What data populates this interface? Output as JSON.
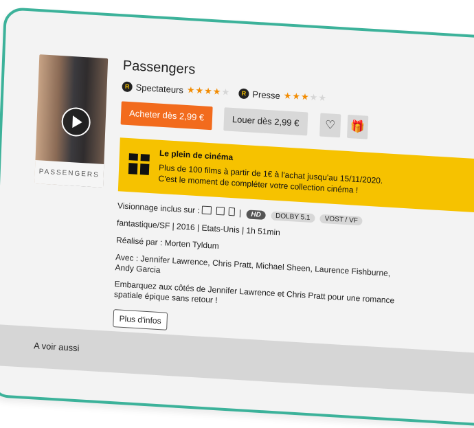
{
  "movie": {
    "title": "Passengers",
    "poster_text": "PASSENGERS",
    "spectators_label": "Spectateurs",
    "spectators_stars": 4,
    "press_label": "Presse",
    "press_stars": 3
  },
  "actions": {
    "buy_label": "Acheter dès 2,99 €",
    "rent_label": "Louer dès 2,99 €"
  },
  "promo": {
    "title": "Le plein de cinéma",
    "line1": "Plus de 100 films à partir de 1€ à l'achat jusqu'au 15/11/2020.",
    "line2": "C'est le moment de compléter votre collection cinéma !"
  },
  "details": {
    "viewing_label": "Visionnage inclus sur :",
    "tags": [
      "HD",
      "DOLBY 5.1",
      "VOST / VF"
    ],
    "genre_line": "fantastique/SF | 2016 | Etats-Unis | 1h 51min",
    "director_line": "Réalisé par : Morten Tyldum",
    "cast_line1": "Avec : Jennifer Lawrence, Chris Pratt, Michael Sheen, Laurence Fishburne,",
    "cast_line2": "Andy Garcia",
    "synopsis_line1": "Embarquez aux côtés de Jennifer Lawrence et Chris Pratt pour une romance",
    "synopsis_line2": "spatiale épique sans retour !",
    "more_label": "Plus d'infos"
  },
  "footer": {
    "see_also": "A voir aussi"
  },
  "colors": {
    "accent": "#f26b1d",
    "promo": "#f6c200",
    "frame": "#3cb29a"
  }
}
